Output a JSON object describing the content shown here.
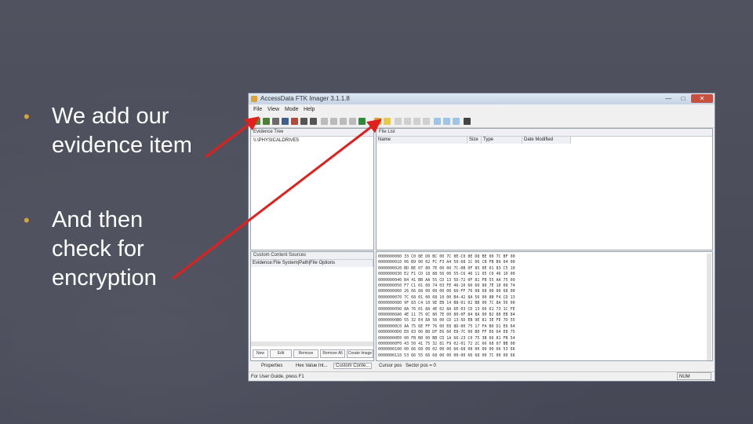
{
  "slide": {
    "bullets": [
      {
        "line1": "We add our",
        "line2": "evidence item"
      },
      {
        "line1": "And then",
        "line2": "check for",
        "line3": "encryption"
      }
    ],
    "bullet_symbol": "•",
    "colors": {
      "background": "#4a4c5c",
      "bullet": "#d8a23a",
      "text": "#ffffff",
      "arrow": "#e0201c"
    }
  },
  "window": {
    "title": "AccessData FTK Imager 3.1.1.8",
    "controls": {
      "minimize": "—",
      "maximize": "□",
      "close": "✕"
    },
    "menu": [
      "File",
      "View",
      "Mode",
      "Help"
    ],
    "evidence_tree": {
      "header": "Evidence Tree",
      "item": "\\\\.\\PHYSICALDRIVE5"
    },
    "file_list": {
      "header": "File List",
      "columns": [
        "Name",
        "Size",
        "Type",
        "Date Modified"
      ]
    },
    "custom_content": {
      "header": "Custom Content Sources",
      "columns": [
        "Evidence:File System|Path|File Options"
      ],
      "buttons": [
        "New",
        "Edit",
        "Remove",
        "Remove All",
        "Create Image"
      ]
    },
    "tabs": [
      "Properties",
      "Hex Value Int...",
      "Custom Conte..."
    ],
    "hex_lines": [
      "0000000000 33 C0 8E D0 BC 00 7C 8E-C0 8E D8 BE 00 7C BF 00",
      "0000000010 06 B9 00 02 FC F3 A4 50-68 1C 06 CB FB B9 04 00",
      "0000000020 BD BE 07 80 7E 00 00 7C-0B 0F 85 0E 01 83 C5 10",
      "0000000030 E2 F1 CD 18 88 56 00 55-C6 46 11 05 C6 46 10 00",
      "0000000040 B4 41 BB AA 55 CD 13 5D-72 0F 81 FB 55 AA 75 09",
      "0000000050 F7 C1 01 00 74 03 FE 46-10 66 60 80 7E 10 00 74",
      "0000000060 26 66 68 00 00 00 00 66-FF 76 08 68 00 00 68 00",
      "0000000070 7C 68 01 00 68 10 00 B4-42 8A 56 00 8B F4 CD 13",
      "0000000080 9F 83 C4 10 9E EB 14 B8-01 02 BB 00 7C 8A 56 00",
      "0000000090 8A 76 01 8A 4E 02 8A 6E-03 CD 13 66 61 73 1C FE",
      "00000000A0 4E 11 75 0C 80 7E 00 80-0F 84 8A 00 B2 80 EB 84",
      "00000000B0 55 32 E4 8A 56 00 CD 13-5D EB 9E 81 3E FE 7D 55",
      "00000000C0 AA 75 6E FF 76 00 E8 8D-00 75 17 FA B0 D1 E6 64",
      "00000000D0 E8 83 00 B0 DF E6 60 E8-7C 00 B0 FF E6 64 E8 75",
      "00000000E0 00 FB B8 00 BB CD 1A 66-23 C0 75 3B 66 81 FB 54",
      "00000000F0 43 50 41 75 32 81 F9 02-01 72 2C 66 68 07 BB 00",
      "0000000100 00 66 68 00 02 00 00 66-68 08 00 00 00 66 53 66",
      "0000000110 53 66 55 66 68 00 00 00-00 66 68 00 7C 00 00 66"
    ],
    "hex_bottom": {
      "cursor_pos": "Cursor pos",
      "sector": "Sector pos = 0"
    },
    "status_text": "For User Guide, press F1",
    "status_num": "NUM"
  }
}
